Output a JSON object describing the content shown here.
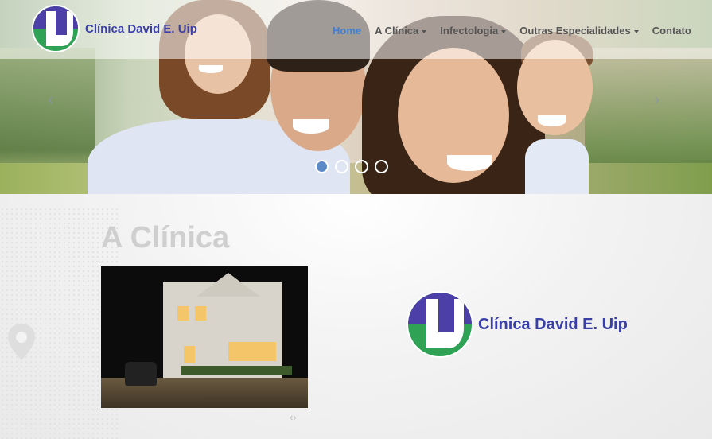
{
  "brand": {
    "name": "Clínica David E. Uip"
  },
  "nav": {
    "items": [
      {
        "label": "Home",
        "active": true,
        "dropdown": false
      },
      {
        "label": "A Clínica",
        "active": false,
        "dropdown": true
      },
      {
        "label": "Infectologia",
        "active": false,
        "dropdown": true
      },
      {
        "label": "Outras Especialidades",
        "active": false,
        "dropdown": true
      },
      {
        "label": "Contato",
        "active": false,
        "dropdown": false
      }
    ]
  },
  "slider": {
    "prev_icon": "chevron-left-icon",
    "next_icon": "chevron-right-icon",
    "slide_count": 4,
    "active_index": 0
  },
  "section": {
    "title": "A Clínica",
    "gallery_controls_icon": "chevron-left-right-icon"
  },
  "colors": {
    "brand_blue": "#3a3fa8",
    "brand_green": "#2fa256",
    "nav_active": "#3f7ed8",
    "dot_active": "#5c89c8"
  }
}
